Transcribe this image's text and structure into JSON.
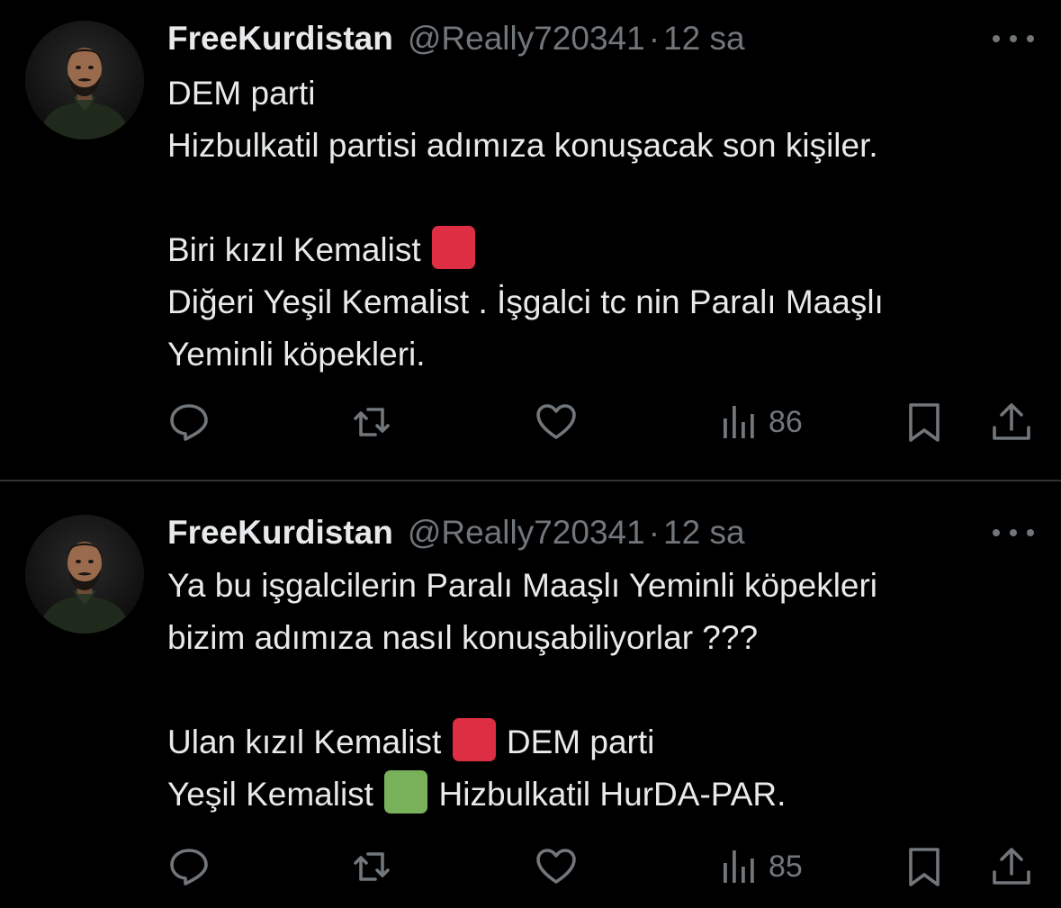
{
  "colors": {
    "background": "#000000",
    "text_primary": "#e7e9ea",
    "text_secondary": "#71767b",
    "divider": "#2f3336",
    "red_square": "#dd2e44",
    "green_square": "#78b159"
  },
  "tweets": [
    {
      "author": {
        "display_name": "FreeKurdistan",
        "handle": "@Really720341",
        "separator": "·",
        "time": "12 sa",
        "avatar_icon": "profile-photo-bearded-man"
      },
      "more_icon": "more-horizontal-icon",
      "lines": {
        "l1": "DEM parti",
        "l2": "Hizbulkatil partisi adımıza konuşacak son kişiler.",
        "l3": "Biri kızıl Kemalist",
        "l3_emoji": "red-square-emoji",
        "l4": "Diğeri Yeşil Kemalist . İşgalci tc nin Paralı Maaşlı",
        "l5": "Yeminli köpekleri."
      },
      "actions": {
        "reply_icon": "reply-icon",
        "retweet_icon": "retweet-icon",
        "like_icon": "heart-icon",
        "views_icon": "views-chart-icon",
        "views_count": "86",
        "bookmark_icon": "bookmark-icon",
        "share_icon": "share-icon"
      }
    },
    {
      "author": {
        "display_name": "FreeKurdistan",
        "handle": "@Really720341",
        "separator": "·",
        "time": "12 sa",
        "avatar_icon": "profile-photo-bearded-man"
      },
      "more_icon": "more-horizontal-icon",
      "lines": {
        "l1": "Ya bu işgalcilerin Paralı Maaşlı Yeminli köpekleri",
        "l2": "bizim adımıza nasıl konuşabiliyorlar ???",
        "l3_before": "Ulan kızıl Kemalist",
        "l3_emoji": "red-square-emoji",
        "l3_after": "DEM parti",
        "l4_before": "Yeşil Kemalist",
        "l4_emoji": "green-square-emoji",
        "l4_after": "Hizbulkatil HurDA-PAR."
      },
      "actions": {
        "reply_icon": "reply-icon",
        "retweet_icon": "retweet-icon",
        "like_icon": "heart-icon",
        "views_icon": "views-chart-icon",
        "views_count": "85",
        "bookmark_icon": "bookmark-icon",
        "share_icon": "share-icon"
      }
    }
  ]
}
